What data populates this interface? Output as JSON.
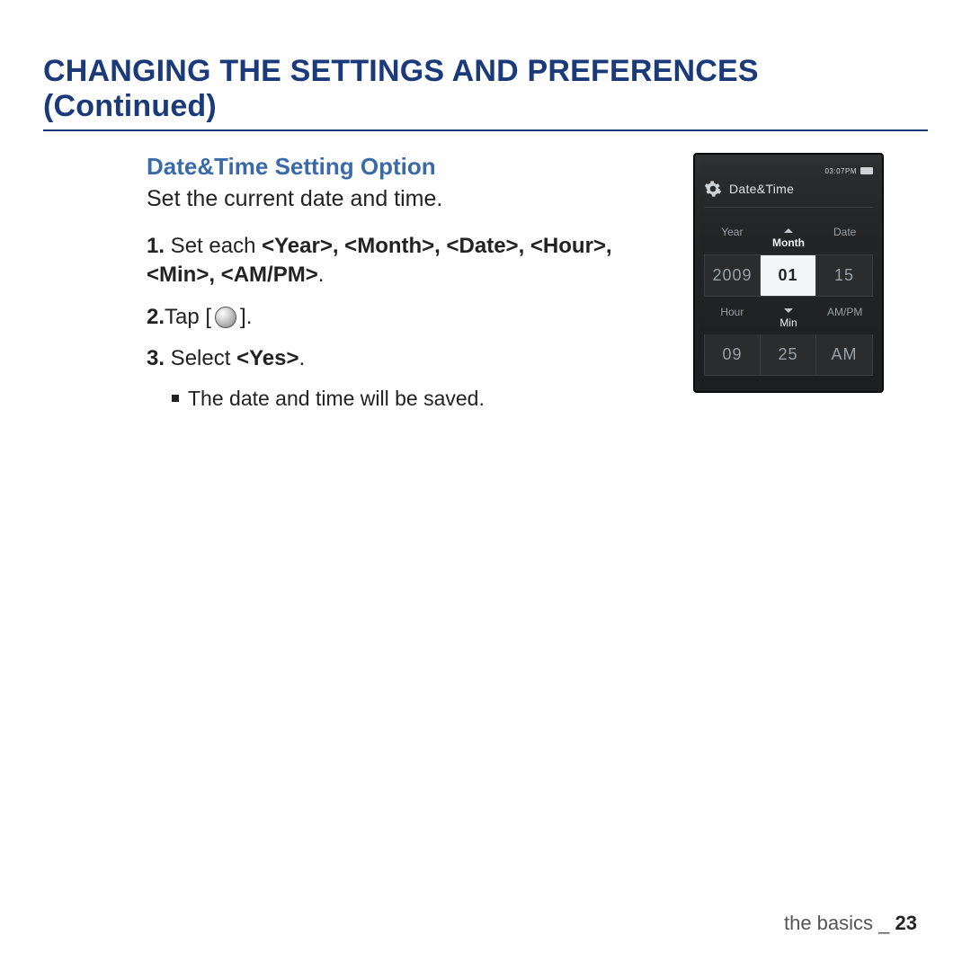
{
  "title": "CHANGING THE SETTINGS AND PREFERENCES (Continued)",
  "section": {
    "heading": "Date&Time Setting Option",
    "sub": "Set the current date and time."
  },
  "steps": {
    "s1_num": "1.",
    "s1_lead": " Set each ",
    "s1_fields": "<Year>, <Month>, <Date>, <Hour>, <Min>, <AM/PM>",
    "s1_tail": ".",
    "s2_num": "2.",
    "s2_lead": " Tap [",
    "s2_tail": "].",
    "s3_num": "3.",
    "s3_lead": " Select ",
    "s3_field": "<Yes>",
    "s3_tail": ".",
    "note": "The date and time will be saved."
  },
  "device": {
    "status_time": "03:07PM",
    "title": "Date&Time",
    "row1": {
      "labels": [
        "Year",
        "Month",
        "Date"
      ],
      "values": [
        "2009",
        "01",
        "15"
      ],
      "selected_index": 1
    },
    "row2": {
      "labels": [
        "Hour",
        "Min",
        "AM/PM"
      ],
      "values": [
        "09",
        "25",
        "AM"
      ],
      "selected_index": -1
    }
  },
  "footer": {
    "section": "the basics",
    "sep": " _ ",
    "page": "23"
  }
}
